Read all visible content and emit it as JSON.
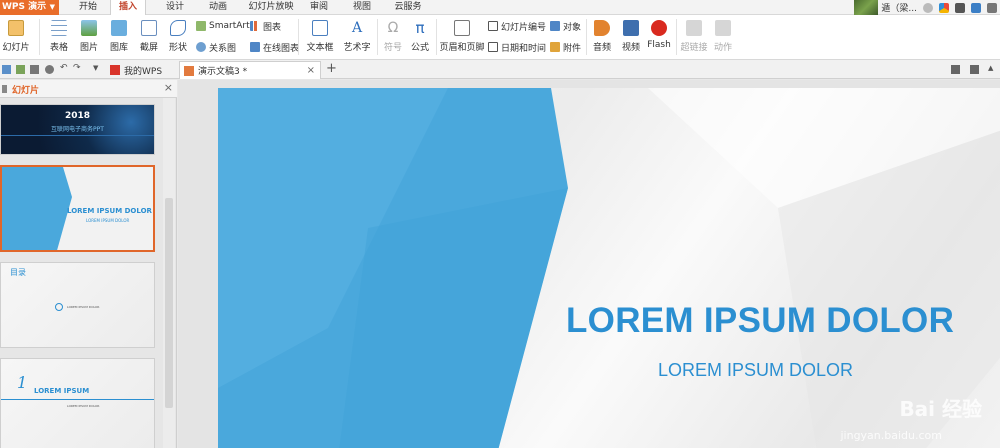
{
  "app": {
    "name": "WPS 演示"
  },
  "menu": {
    "tabs": [
      "开始",
      "插入",
      "设计",
      "动画",
      "幻灯片放映",
      "审阅",
      "视图",
      "云服务"
    ],
    "active": "插入",
    "user_name": "遁（梁..."
  },
  "ribbon": {
    "slide": "幻灯片",
    "table": "表格",
    "picture": "图片",
    "gallery": "图库",
    "screenshot": "截屏",
    "shape": "形状",
    "smartart": "SmartArt",
    "chart": "图表",
    "relation": "关系图",
    "online_chart": "在线图表",
    "textbox": "文本框",
    "wordart": "艺术字",
    "symbol": "符号",
    "formula": "公式",
    "header_footer": "页眉和页脚",
    "slide_number": "幻灯片编号",
    "object": "对象",
    "datetime": "日期和时间",
    "attachment": "附件",
    "audio": "音频",
    "video": "视频",
    "flash": "Flash",
    "hyperlink": "超链接",
    "action": "动作"
  },
  "doc_tabs": [
    {
      "label": "我的WPS"
    },
    {
      "label": "演示文稿3 *"
    }
  ],
  "panel": {
    "title": "幻灯片"
  },
  "thumbnails": {
    "t1_year": "2018",
    "t1_sub": "互联网电子商务PPT",
    "t2_title": "LOREM IPSUM DOLOR",
    "t2_sub": "LOREM IPSUM DOLOR",
    "t3_title": "目录",
    "t3_item": "LOREM IPSUM DOLOR",
    "t4_num": "1",
    "t4_title": "LOREM IPSUM",
    "t4_sub": "LOREM IPSUM DOLOR"
  },
  "slide": {
    "title": "LOREM IPSUM DOLOR",
    "subtitle": "LOREM IPSUM DOLOR"
  },
  "watermark": {
    "brand": "Bai 经验",
    "url": "jingyan.baidu.com"
  },
  "colors": {
    "accent": "#e96d2a",
    "slide_blue": "#2b8fd1",
    "panel_blue": "#4aa8dc"
  }
}
